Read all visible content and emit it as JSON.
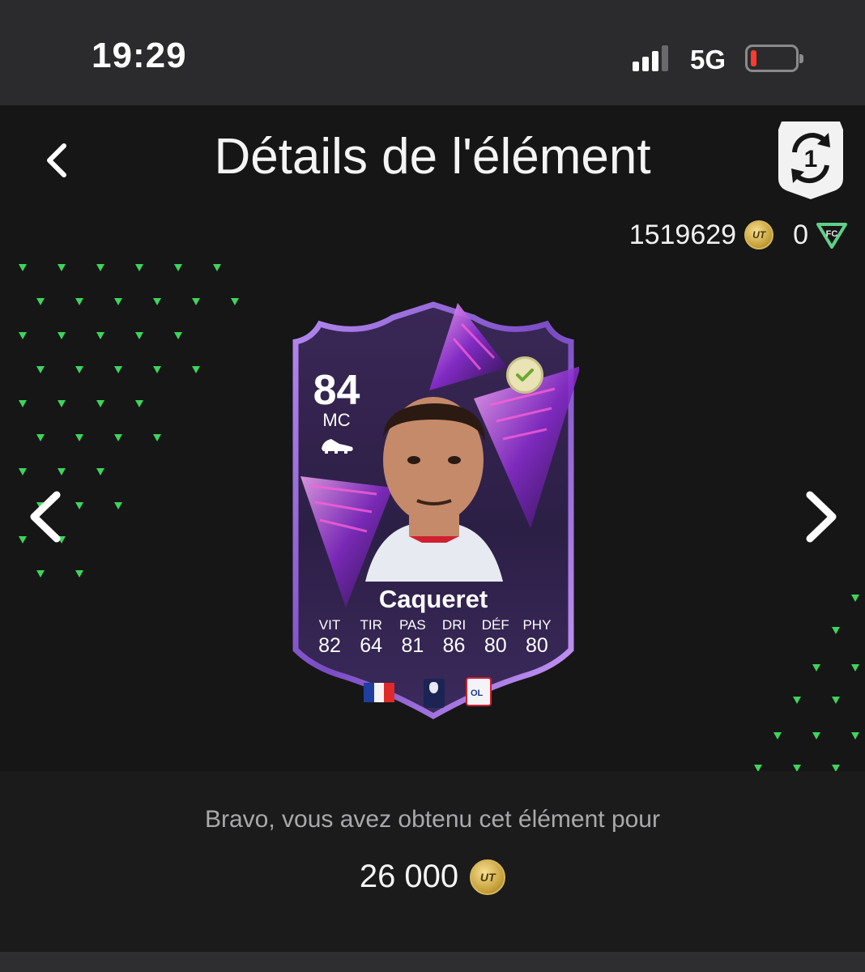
{
  "status_bar": {
    "time": "19:29",
    "network": "5G",
    "battery_level": 0.08
  },
  "header": {
    "title": "Détails de l'élément",
    "transfer_badge_number": "1"
  },
  "balance": {
    "coins": "1519629",
    "points": "0",
    "coin_icon": "coin-icon",
    "points_icon": "fc-points-icon"
  },
  "card": {
    "rating": "84",
    "position": "MC",
    "name": "Caqueret",
    "stats": [
      {
        "label": "VIT",
        "value": "82"
      },
      {
        "label": "TIR",
        "value": "64"
      },
      {
        "label": "PAS",
        "value": "81"
      },
      {
        "label": "DRI",
        "value": "86"
      },
      {
        "label": "DÉF",
        "value": "80"
      },
      {
        "label": "PHY",
        "value": "80"
      }
    ],
    "nation": "France",
    "league": "Ligue 1",
    "club": "Olympique Lyonnais",
    "owned": true
  },
  "reward": {
    "message": "Bravo, vous avez obtenu cet élément pour",
    "amount": "26 000"
  },
  "colors": {
    "accent_green": "#3ed45c",
    "card_purple": "#6a3ca8",
    "coin_gold": "#d4b24c"
  }
}
